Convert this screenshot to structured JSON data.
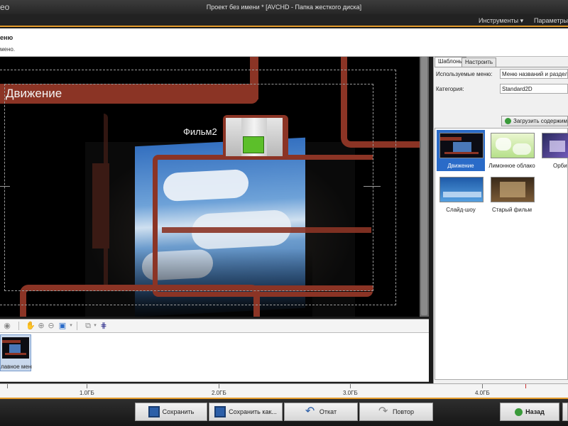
{
  "window": {
    "app_fragment": "eo",
    "title": "Проект без имени * [AVCHD - Папка жесткого диска]"
  },
  "menu": {
    "tools": "Инструменты ▾",
    "params": "Параметры"
  },
  "header": {
    "title": "еню",
    "subtitle": "мено."
  },
  "preview": {
    "menu_title": "Движение",
    "film_label": "Фильм2"
  },
  "menu_strip": {
    "item_label": "лавное меню"
  },
  "ruler": {
    "labels": [
      "1.0ГБ",
      "2.0ГБ",
      "3.0ГБ",
      "4.0ГБ"
    ]
  },
  "bottom": {
    "save": "Сохранить",
    "save_as": "Сохранить как...",
    "undo": "Откат",
    "redo": "Повтор",
    "back": "Назад"
  },
  "right_panel": {
    "tabs": [
      "Шаблоны",
      "Настроить"
    ],
    "used_menu_label": "Используемые меню:",
    "used_menu_value": "Меню названий и разделов",
    "category_label": "Категория:",
    "category_value": "Standard2D",
    "load_button": "Загрузить содержимое",
    "templates": [
      {
        "label": "Движение",
        "selected": true
      },
      {
        "label": "Лимонное облако",
        "selected": false
      },
      {
        "label": "Орби",
        "selected": false
      },
      {
        "label": "Слайд-шоу",
        "selected": false
      },
      {
        "label": "Старый фильм",
        "selected": false
      }
    ]
  },
  "colors": {
    "accent": "#e39b2b",
    "menu_bar_red": "#8b3425",
    "selection": "#2a6bc8"
  }
}
